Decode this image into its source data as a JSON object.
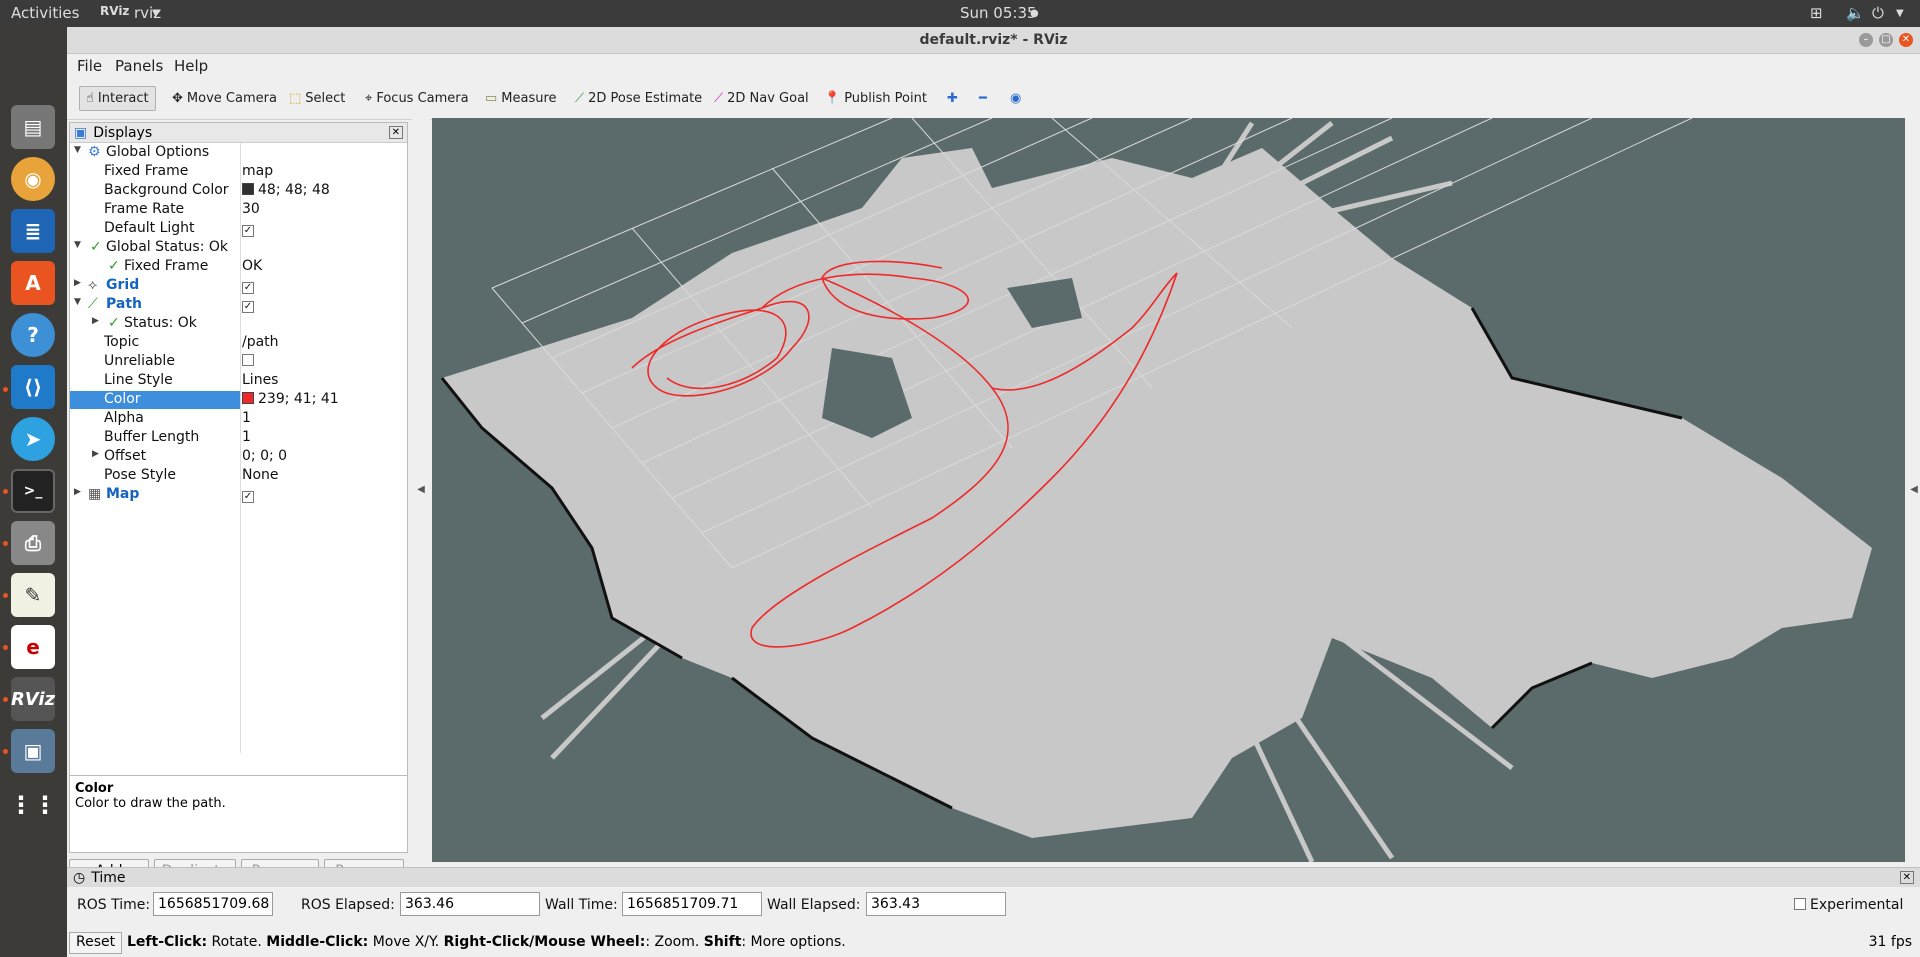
{
  "topbar": {
    "activities": "Activities",
    "app": "rviz",
    "clock": "Sun 05:35"
  },
  "window": {
    "title": "default.rviz* - RViz"
  },
  "menu": [
    "File",
    "Panels",
    "Help"
  ],
  "toolbar": {
    "interact": "Interact",
    "move_camera": "Move Camera",
    "select": "Select",
    "focus_camera": "Focus Camera",
    "measure": "Measure",
    "pose_estimate": "2D Pose Estimate",
    "nav_goal": "2D Nav Goal",
    "publish_point": "Publish Point"
  },
  "displays": {
    "title": "Displays",
    "rows": [
      {
        "key": "Global Options",
        "value": ""
      },
      {
        "key": "Fixed Frame",
        "value": "map"
      },
      {
        "key": "Background Color",
        "value": "48; 48; 48"
      },
      {
        "key": "Frame Rate",
        "value": "30"
      },
      {
        "key": "Default Light",
        "value": ""
      },
      {
        "key": "Global Status: Ok",
        "value": ""
      },
      {
        "key": "Fixed Frame",
        "value": "OK"
      },
      {
        "key": "Grid",
        "value": ""
      },
      {
        "key": "Path",
        "value": ""
      },
      {
        "key": "Status: Ok",
        "value": ""
      },
      {
        "key": "Topic",
        "value": "/path"
      },
      {
        "key": "Unreliable",
        "value": ""
      },
      {
        "key": "Line Style",
        "value": "Lines"
      },
      {
        "key": "Color",
        "value": "239; 41; 41"
      },
      {
        "key": "Alpha",
        "value": "1"
      },
      {
        "key": "Buffer Length",
        "value": "1"
      },
      {
        "key": "Offset",
        "value": "0; 0; 0"
      },
      {
        "key": "Pose Style",
        "value": "None"
      },
      {
        "key": "Map",
        "value": ""
      }
    ],
    "bg_swatch": "#303030",
    "path_swatch": "#ef2929"
  },
  "description": {
    "title": "Color",
    "text": "Color to draw the path."
  },
  "buttons": {
    "add": "Add",
    "duplicate": "Duplicate",
    "remove": "Remove",
    "rename": "Rename"
  },
  "time": {
    "title": "Time",
    "ros_time_label": "ROS Time:",
    "ros_time": "1656851709.68",
    "ros_elapsed_label": "ROS Elapsed:",
    "ros_elapsed": "363.46",
    "wall_time_label": "Wall Time:",
    "wall_time": "1656851709.71",
    "wall_elapsed_label": "Wall Elapsed:",
    "wall_elapsed": "363.43",
    "experimental": "Experimental"
  },
  "status": {
    "reset": "Reset",
    "lc": "Left-Click:",
    "lc_t": " Rotate. ",
    "mc": "Middle-Click:",
    "mc_t": " Move X/Y. ",
    "rc": "Right-Click/Mouse Wheel:",
    "rc_t": ": Zoom. ",
    "sh": "Shift",
    "sh_t": ": More options.",
    "fps": "31 fps"
  }
}
